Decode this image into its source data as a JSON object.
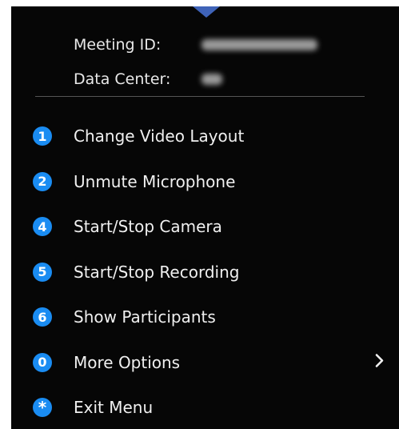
{
  "info": {
    "meeting_id_label": "Meeting ID:",
    "data_center_label": "Data Center:"
  },
  "menu": {
    "items": [
      {
        "key": "1",
        "label": "Change Video Layout"
      },
      {
        "key": "2",
        "label": "Unmute Microphone"
      },
      {
        "key": "4",
        "label": "Start/Stop Camera"
      },
      {
        "key": "5",
        "label": "Start/Stop Recording"
      },
      {
        "key": "6",
        "label": "Show Participants"
      },
      {
        "key": "0",
        "label": "More Options",
        "has_submenu": true
      },
      {
        "key": "*",
        "label": "Exit Menu"
      }
    ]
  },
  "colors": {
    "background": "#060606",
    "badge": "#1a8cf2",
    "pointer": "#3f63b8",
    "text": "#f0f0f0"
  },
  "icons": {
    "submenu": "chevron-right-icon",
    "pointer": "pointer-arrow-icon"
  }
}
